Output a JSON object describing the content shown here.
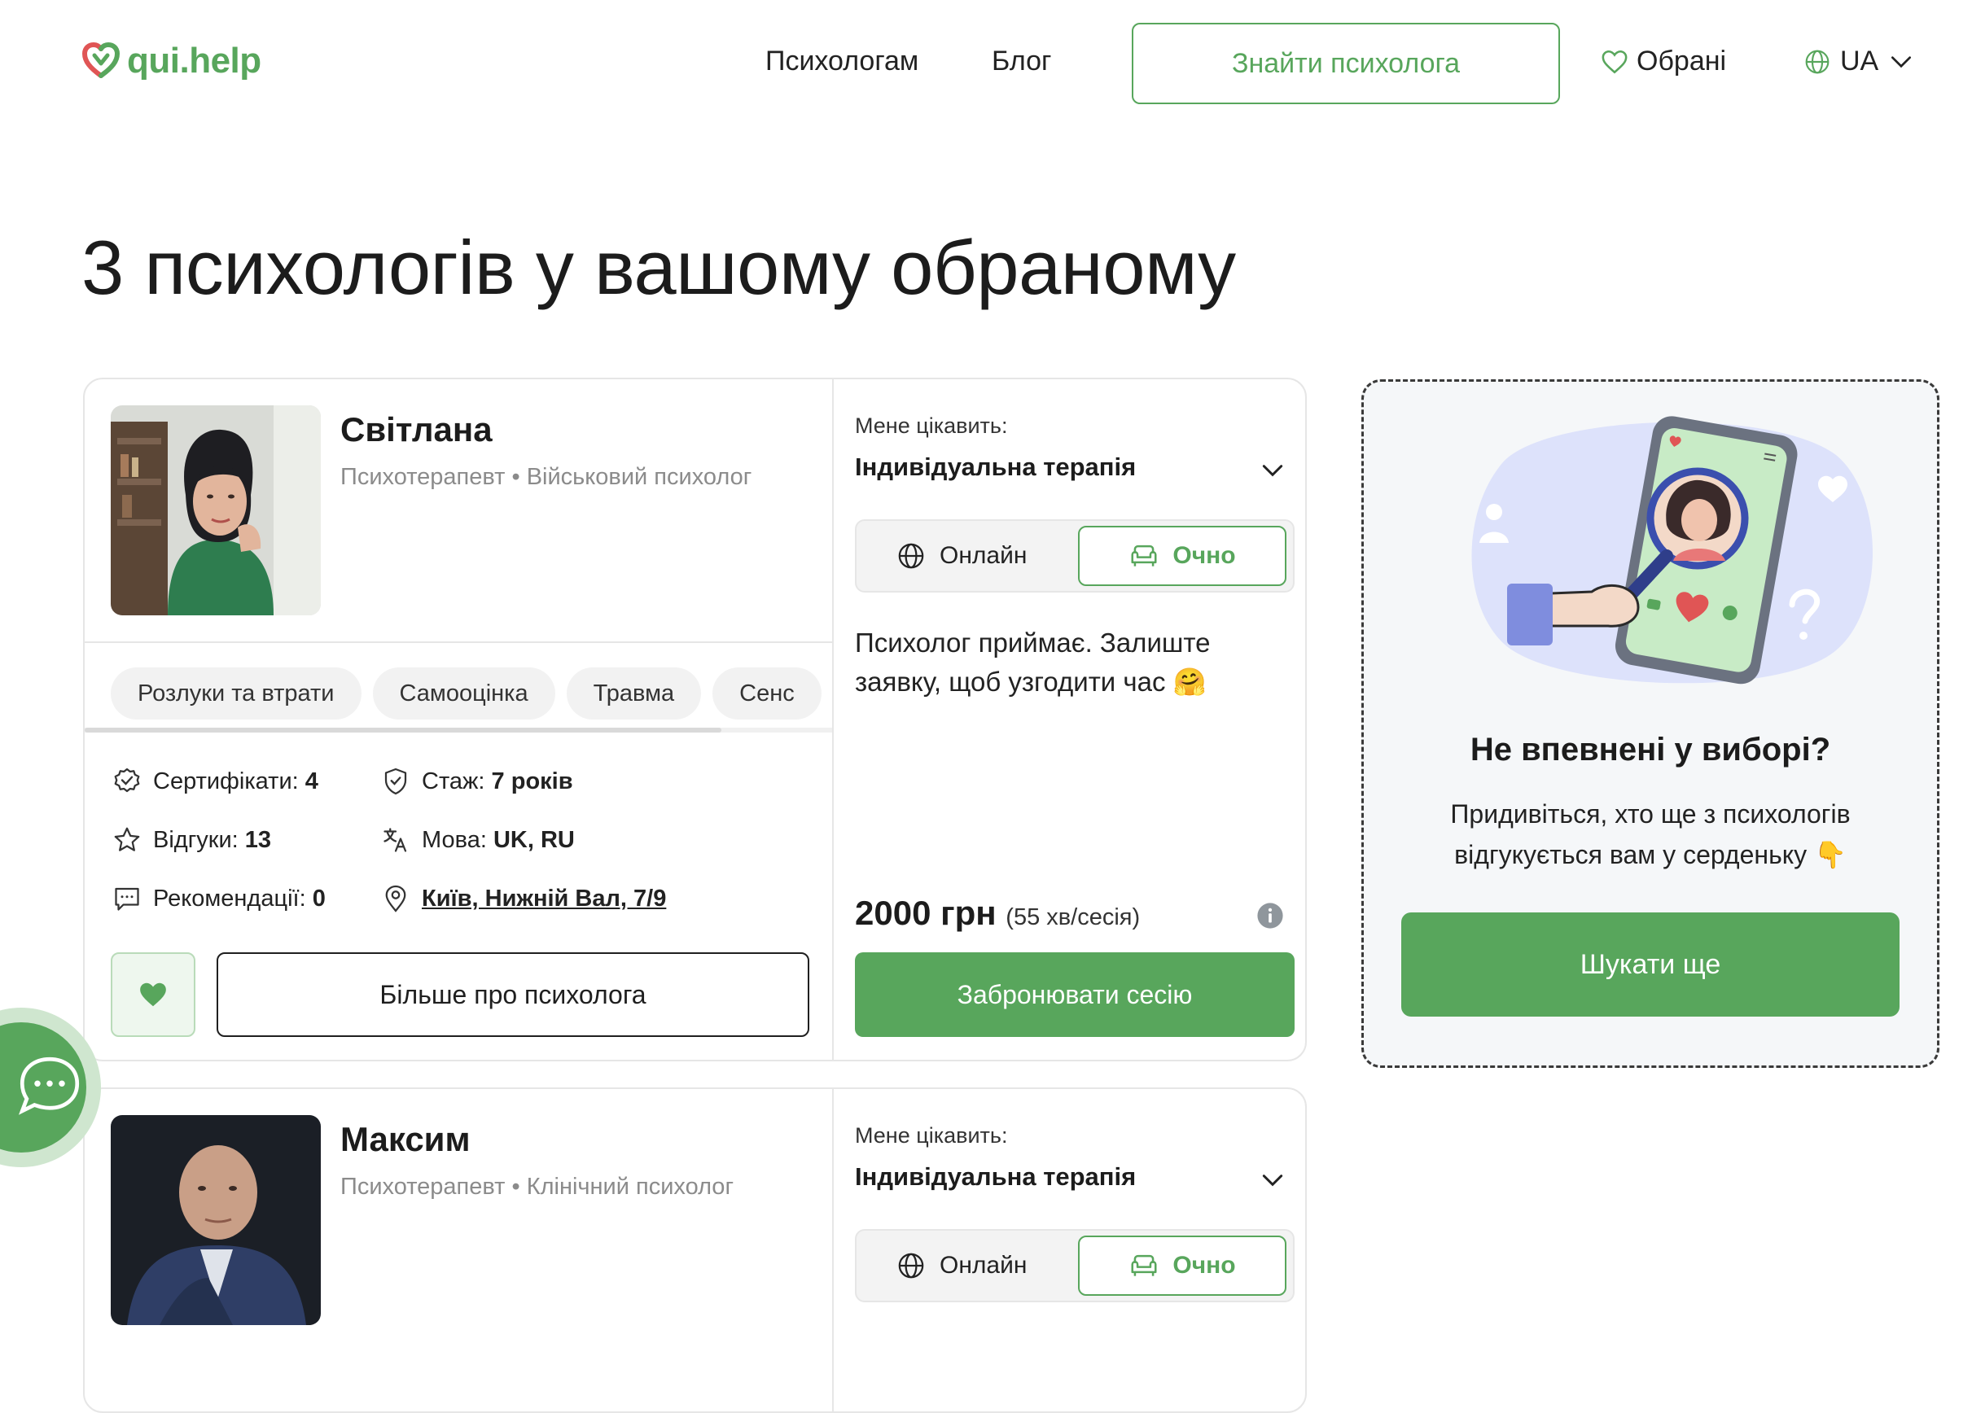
{
  "header": {
    "logo_text": "qui.help",
    "nav": [
      "Психологам",
      "Блог"
    ],
    "find_button": "Знайти психолога",
    "favorites": "Обрані",
    "language": "UA"
  },
  "page_title": "3 психологів у вашому обраному",
  "cards": [
    {
      "name": "Світлана",
      "role": "Психотерапевт • Військовий психолог",
      "tags": [
        "Розлуки та втрати",
        "Самооцінка",
        "Травма",
        "Сенс"
      ],
      "certificates_label": "Сертифікати:",
      "certificates": "4",
      "experience_label": "Стаж:",
      "experience": "7 років",
      "reviews_label": "Відгуки:",
      "reviews": "13",
      "language_label": "Мова:",
      "languages": "UK, RU",
      "recommendations_label": "Рекомендації:",
      "recommendations": "0",
      "location": "Київ, Нижній Вал, 7/9",
      "more_button": "Більше про психолога",
      "interest_label": "Мене цікавить:",
      "interest_value": "Індивідуальна терапія",
      "mode_online": "Онлайн",
      "mode_offline": "Очно",
      "accept_text": "Психолог приймає. Залиште заявку, щоб узгодити час 🤗",
      "price": "2000 грн",
      "price_note": "(55 хв/сесія)",
      "book_button": "Забронювати сесію"
    },
    {
      "name": "Максим",
      "role": "Психотерапевт • Клінічний психолог",
      "interest_label": "Мене цікавить:",
      "interest_value": "Індивідуальна терапія",
      "mode_online": "Онлайн",
      "mode_offline": "Очно"
    }
  ],
  "side_panel": {
    "title": "Не впевнені у виборі?",
    "text": "Придивіться, хто ще з психологів відгукується вам у серденьку 👇",
    "button": "Шукати ще"
  },
  "colors": {
    "accent": "#58a65c",
    "accent_light": "#eef7ee",
    "border": "#e6e6e6",
    "panel_bg": "#f5f7f9"
  }
}
